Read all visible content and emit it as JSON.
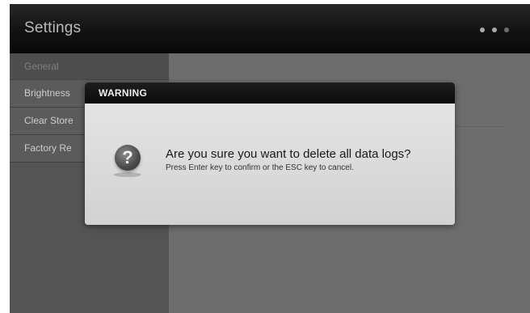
{
  "app": {
    "title": "Settings"
  },
  "pager": {
    "dots": 3,
    "active_index": 1
  },
  "sidebar": {
    "header": "General",
    "items": [
      {
        "label": "Brightness"
      },
      {
        "label": "Clear Store"
      },
      {
        "label": "Factory Re"
      }
    ]
  },
  "dialog": {
    "title": "WARNING",
    "icon": "question-icon",
    "icon_glyph": "?",
    "message": "Are you sure you want to delete all data logs?",
    "hint": "Press Enter key to confirm or the ESC key to cancel."
  },
  "colors": {
    "topbar": "#111111",
    "sidebar": "#5e5e5e",
    "content": "#7a7a7a",
    "dialog_body": "#dcdcdc",
    "dialog_header": "#0b0b0b"
  }
}
